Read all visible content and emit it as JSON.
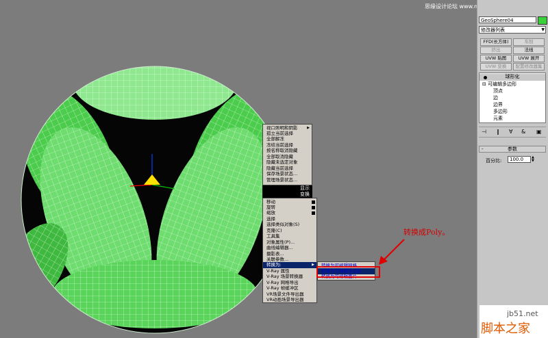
{
  "viewport": {
    "label": "3D viewport - GeoSphere04"
  },
  "panel": {
    "object_name": "GeoSphere04",
    "modifier_list": "修改器列表",
    "buttons": [
      {
        "label": "FFD(长方体)",
        "dim": false
      },
      {
        "label": "车削",
        "dim": true
      },
      {
        "label": "挤出",
        "dim": true
      },
      {
        "label": "法线",
        "dim": false
      },
      {
        "label": "UVW 贴图",
        "dim": false
      },
      {
        "label": "UVW 展开",
        "dim": false
      },
      {
        "label": "UVW 变换",
        "dim": true
      },
      {
        "label": "配置修改器集",
        "dim": true
      }
    ],
    "stack_header": "球形化",
    "stack_items": [
      {
        "label": "可编辑多边形",
        "indent": 0
      },
      {
        "label": "顶点",
        "indent": 1
      },
      {
        "label": "边",
        "indent": 1
      },
      {
        "label": "边界",
        "indent": 1
      },
      {
        "label": "多边形",
        "indent": 1
      },
      {
        "label": "元素",
        "indent": 1
      }
    ],
    "rollout_title": "参数",
    "percent_label": "百分比:",
    "percent_value": "100.0"
  },
  "context_menu": {
    "upper_items": [
      {
        "label": "视口照明和阴影",
        "sub": true
      },
      {
        "label": "孤立当前选择"
      },
      {
        "label": "全部解冻"
      },
      {
        "label": "冻结当前选择"
      },
      {
        "label": "按名称取消隐藏"
      },
      {
        "label": "全部取消隐藏"
      },
      {
        "label": "隐藏未选定对象"
      },
      {
        "label": "隐藏当前选择"
      },
      {
        "label": "保存场景状态..."
      },
      {
        "label": "管理场景状态..."
      }
    ],
    "display_header": "显示",
    "transform_header": "变换",
    "lower_items": [
      {
        "label": "移动",
        "box": true
      },
      {
        "label": "旋转",
        "box": true
      },
      {
        "label": "缩放",
        "box": true
      },
      {
        "label": "选择"
      },
      {
        "label": "选择类似对象(S)"
      },
      {
        "label": "克隆(C)"
      },
      {
        "label": "工具集"
      },
      {
        "label": "对象属性(P)..."
      },
      {
        "label": "曲线编辑器..."
      },
      {
        "label": "摄影表..."
      },
      {
        "label": "关联参数..."
      },
      {
        "label": "转换为:",
        "sub": true,
        "highlight": true
      },
      {
        "label": "V-Ray 属性"
      },
      {
        "label": "V-Ray 场景转换器"
      },
      {
        "label": "V-Ray 网格导出"
      },
      {
        "label": "V-Ray 帧缓冲区"
      },
      {
        "label": "VR场景文件导出器"
      },
      {
        "label": "VR动画场景导出器"
      }
    ],
    "submenu_items": [
      {
        "label": "转换为可编辑网格"
      },
      {
        "label": "转换为可编辑多边形",
        "highlight": true
      },
      {
        "label": "转换为可编辑面片"
      }
    ]
  },
  "annotation": {
    "text": "转换成Poly。"
  },
  "watermark": {
    "top": "思缘设计论坛 www.missyuan.com",
    "site": "jb51.net",
    "brand": "脚本之家"
  },
  "colors": {
    "green_light": "#7fe07f",
    "green_dark": "#3ac43a",
    "annotation_red": "#e00000",
    "menu_highlight": "#0a246a"
  }
}
